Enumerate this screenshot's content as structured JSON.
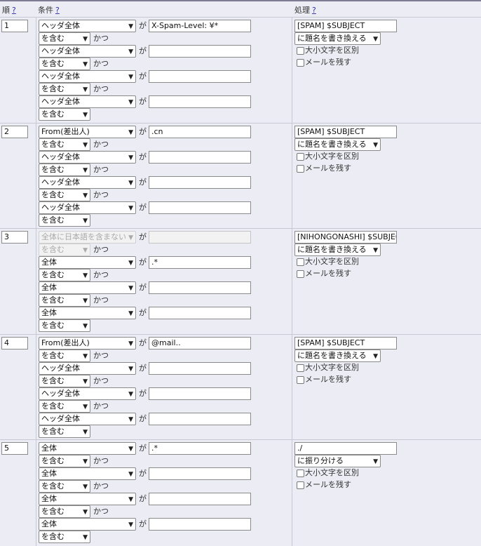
{
  "header": {
    "order": "順",
    "condition": "条件",
    "action": "処理",
    "help": "?"
  },
  "labels": {
    "ga": "が",
    "katsu": "かつ",
    "case_sensitive": "大小文字を区別",
    "keep_mail": "メールを残す"
  },
  "rules": [
    {
      "order": "1",
      "conditions": [
        {
          "field": "ヘッダ全体",
          "value": "X-Spam-Level: ¥*",
          "op": "を含む"
        },
        {
          "field": "ヘッダ全体",
          "value": "",
          "op": "を含む"
        },
        {
          "field": "ヘッダ全体",
          "value": "",
          "op": "を含む"
        },
        {
          "field": "ヘッダ全体",
          "value": "",
          "op": "を含む"
        }
      ],
      "action_value": "[SPAM] $SUBJECT",
      "action_type": "に題名を書き換える"
    },
    {
      "order": "2",
      "conditions": [
        {
          "field": " From(差出人)",
          "value": ".cn",
          "op": "を含む"
        },
        {
          "field": "ヘッダ全体",
          "value": "",
          "op": "を含む"
        },
        {
          "field": "ヘッダ全体",
          "value": "",
          "op": "を含む"
        },
        {
          "field": "ヘッダ全体",
          "value": "",
          "op": "を含む"
        }
      ],
      "action_value": "[SPAM] $SUBJECT",
      "action_type": "に題名を書き換える"
    },
    {
      "order": "3",
      "conditions": [
        {
          "field": "全体に日本語を含まない",
          "value": "",
          "op": "を含む",
          "disabled": true
        },
        {
          "field": "全体",
          "value": ".*",
          "op": "を含む"
        },
        {
          "field": "全体",
          "value": "",
          "op": "を含む"
        },
        {
          "field": "全体",
          "value": "",
          "op": "を含む"
        }
      ],
      "action_value": "[NIHONGONASHI] $SUBJECT",
      "action_type": "に題名を書き換える"
    },
    {
      "order": "4",
      "conditions": [
        {
          "field": " From(差出人)",
          "value": "@mail..",
          "op": "を含む"
        },
        {
          "field": "ヘッダ全体",
          "value": "",
          "op": "を含む"
        },
        {
          "field": "ヘッダ全体",
          "value": "",
          "op": "を含む"
        },
        {
          "field": "ヘッダ全体",
          "value": "",
          "op": "を含む"
        }
      ],
      "action_value": "[SPAM] $SUBJECT",
      "action_type": "に題名を書き換える"
    },
    {
      "order": "5",
      "conditions": [
        {
          "field": "全体",
          "value": ".*",
          "op": "を含む"
        },
        {
          "field": "全体",
          "value": "",
          "op": "を含む"
        },
        {
          "field": "全体",
          "value": "",
          "op": "を含む"
        },
        {
          "field": "全体",
          "value": "",
          "op": "を含む"
        }
      ],
      "action_value": "./",
      "action_type": "に振り分ける"
    }
  ]
}
